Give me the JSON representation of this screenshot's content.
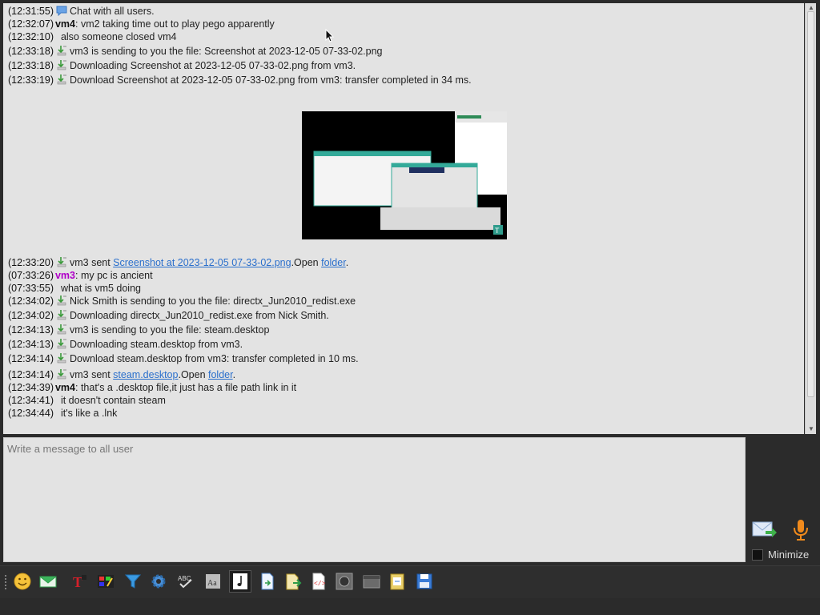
{
  "chat": {
    "top_lines": [
      {
        "time": "(12:31:55)",
        "icon": "chat-bubble-icon",
        "text": "Chat with all users."
      },
      {
        "time": "(12:32:07)",
        "nick": "vm4",
        "nick_color": "#111111",
        "text": ": vm2 taking time out to play pego apparently"
      },
      {
        "time": "(12:32:10)",
        "text": "also someone closed vm4"
      },
      {
        "time": "(12:33:18)",
        "icon": "file-transfer-icon",
        "text": "vm3 is sending to you the file: Screenshot at 2023-12-05 07-33-02.png"
      },
      {
        "time": "(12:33:18)",
        "icon": "file-transfer-icon",
        "text": "Downloading Screenshot at 2023-12-05 07-33-02.png from vm3."
      },
      {
        "time": "(12:33:19)",
        "icon": "file-transfer-icon",
        "text": "Download Screenshot at 2023-12-05 07-33-02.png from vm3: transfer completed in 34 ms."
      }
    ],
    "sent_screenshot": {
      "time": "(12:33:20)",
      "sender": "vm3 sent ",
      "file": "Screenshot at 2023-12-05 07-33-02.png",
      "open": ".Open ",
      "folder": "folder",
      "end": "."
    },
    "lines_after": [
      {
        "time": "(07:33:26)",
        "nick": "vm3",
        "nick_color": "#b000c8",
        "text": ": my pc is ancient"
      },
      {
        "time": "(07:33:55)",
        "text": "what is vm5 doing"
      },
      {
        "time": "(12:34:02)",
        "icon": "file-transfer-icon",
        "text": "Nick Smith is sending to you the file: directx_Jun2010_redist.exe"
      },
      {
        "time": "(12:34:02)",
        "icon": "file-transfer-icon",
        "text": "Downloading directx_Jun2010_redist.exe from Nick Smith."
      },
      {
        "time": "(12:34:13)",
        "icon": "file-transfer-icon",
        "text": "vm3 is sending to you the file: steam.desktop"
      },
      {
        "time": "(12:34:13)",
        "icon": "file-transfer-icon",
        "text": "Downloading steam.desktop from vm3."
      },
      {
        "time": "(12:34:14)",
        "icon": "file-transfer-icon",
        "text": "Download steam.desktop from vm3: transfer completed in 10 ms."
      }
    ],
    "sent_desktop": {
      "time": "(12:34:14)",
      "sender": "vm3 sent ",
      "file": "steam.desktop",
      "open": ".Open ",
      "folder": "folder",
      "end": "."
    },
    "final_lines": [
      {
        "time": "(12:34:39)",
        "nick": "vm4",
        "nick_color": "#111111",
        "text": ": that's a .desktop file,it just has a file path link in it"
      },
      {
        "time": "(12:34:41)",
        "text": "it doesn't contain steam"
      },
      {
        "time": "(12:34:44)",
        "text": "it's like a .lnk"
      }
    ]
  },
  "input": {
    "placeholder": "Write a message to all user"
  },
  "side": {
    "send_icon": "send-message-icon",
    "mic_icon": "microphone-icon",
    "minimize_label": "Minimize"
  },
  "toolbar": [
    {
      "name": "emoji-icon"
    },
    {
      "name": "email-icon"
    },
    {
      "name": "text-format-icon"
    },
    {
      "name": "color-palette-icon"
    },
    {
      "name": "filter-icon"
    },
    {
      "name": "settings-gear-icon"
    },
    {
      "name": "spell-check-icon"
    },
    {
      "name": "font-icon"
    },
    {
      "name": "music-note-icon"
    },
    {
      "name": "send-file-icon"
    },
    {
      "name": "share-file-icon"
    },
    {
      "name": "code-snippet-icon"
    },
    {
      "name": "record-icon"
    },
    {
      "name": "window-icon"
    },
    {
      "name": "clipboard-icon"
    },
    {
      "name": "save-icon"
    }
  ],
  "colors": {
    "link": "#2a6fcc",
    "vm3_nick": "#b000c8",
    "background": "#e3e3e3",
    "chrome": "#2b2b2b"
  }
}
